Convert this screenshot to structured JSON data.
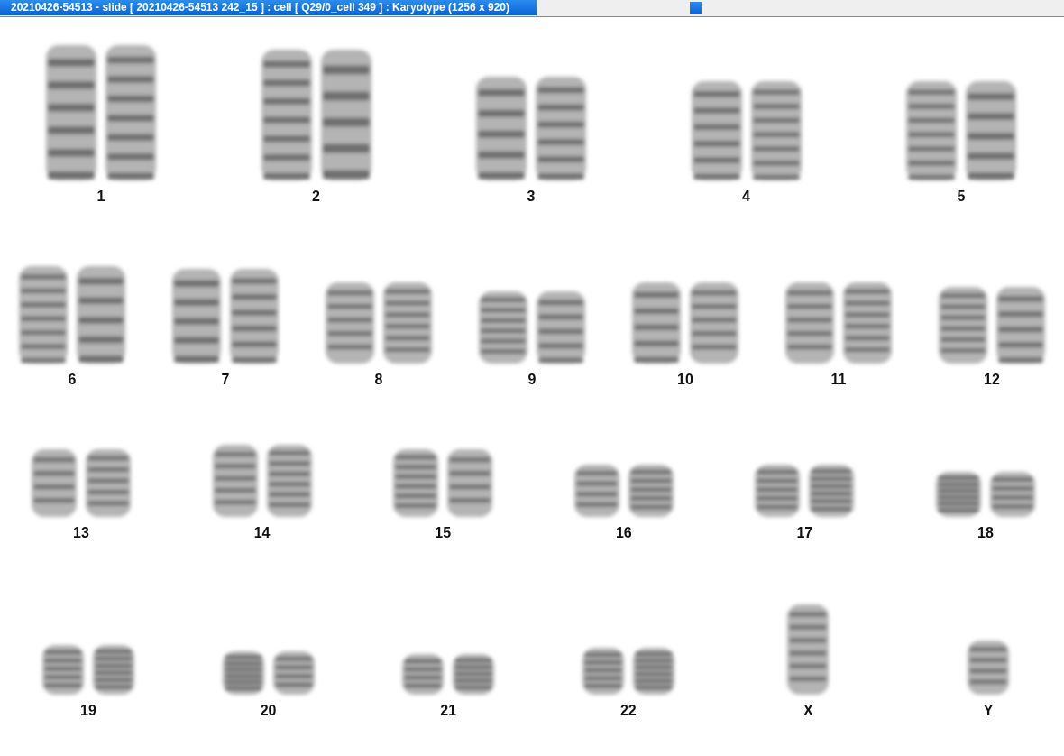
{
  "window": {
    "title": "20210426-54513 - slide [ 20210426-54513 242_15 ] : cell [ Q29/0_cell 349 ] : Karyotype  (1256 x 920)"
  },
  "rows": [
    {
      "items": [
        {
          "label": "1",
          "kind": "pair"
        },
        {
          "label": "2",
          "kind": "pair"
        },
        {
          "label": "3",
          "kind": "pair"
        },
        {
          "label": "4",
          "kind": "pair"
        },
        {
          "label": "5",
          "kind": "pair"
        }
      ]
    },
    {
      "items": [
        {
          "label": "6",
          "kind": "pair"
        },
        {
          "label": "7",
          "kind": "pair"
        },
        {
          "label": "8",
          "kind": "pair"
        },
        {
          "label": "9",
          "kind": "pair"
        },
        {
          "label": "10",
          "kind": "pair"
        },
        {
          "label": "11",
          "kind": "pair"
        },
        {
          "label": "12",
          "kind": "pair"
        }
      ]
    },
    {
      "items": [
        {
          "label": "13",
          "kind": "pair"
        },
        {
          "label": "14",
          "kind": "pair"
        },
        {
          "label": "15",
          "kind": "pair"
        },
        {
          "label": "16",
          "kind": "pair"
        },
        {
          "label": "17",
          "kind": "pair"
        },
        {
          "label": "18",
          "kind": "pair"
        }
      ]
    },
    {
      "items": [
        {
          "label": "19",
          "kind": "pair"
        },
        {
          "label": "20",
          "kind": "pair"
        },
        {
          "label": "21",
          "kind": "pair"
        },
        {
          "label": "22",
          "kind": "pair"
        },
        {
          "label": "X",
          "kind": "single"
        },
        {
          "label": "Y",
          "kind": "single"
        }
      ]
    }
  ]
}
